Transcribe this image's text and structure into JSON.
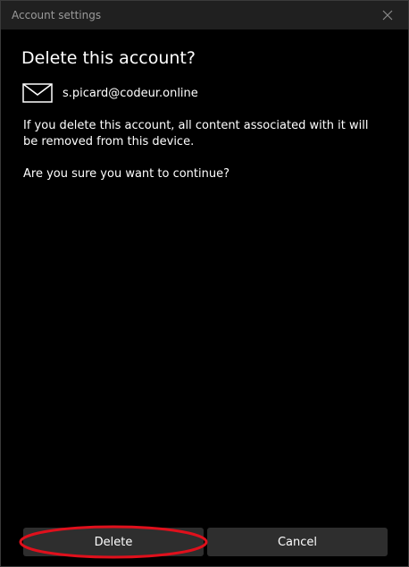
{
  "window": {
    "title": "Account settings",
    "close_icon": "close-icon"
  },
  "dialog": {
    "title": "Delete this account?",
    "account": {
      "icon": "mail-icon",
      "email": "s.picard@codeur.online"
    },
    "warning": "If you delete this account, all content associated with it will be removed from this device.",
    "confirm_question": "Are you sure you want to continue?"
  },
  "buttons": {
    "delete_label": "Delete",
    "cancel_label": "Cancel"
  },
  "annotation": {
    "highlight_color": "#e0101c",
    "highlighted": "delete-button"
  },
  "colors": {
    "background": "#000000",
    "titlebar": "#202020",
    "button": "#2e2e2e"
  }
}
